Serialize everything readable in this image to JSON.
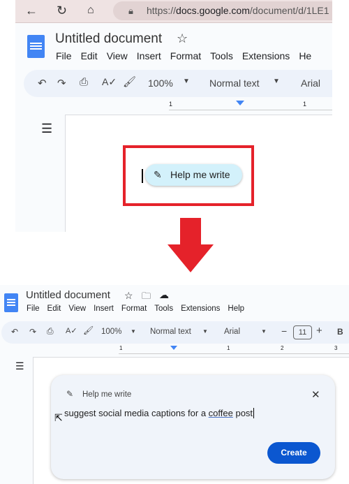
{
  "top": {
    "url_prefix": "https://",
    "url_domain": "docs.google.com",
    "url_path": "/document/d/1LE1",
    "doc_title": "Untitled document",
    "menu": [
      "File",
      "Edit",
      "View",
      "Insert",
      "Format",
      "Tools",
      "Extensions",
      "He"
    ],
    "zoom": "100%",
    "style": "Normal text",
    "font": "Arial",
    "ruler_labels": [
      "1",
      "1"
    ],
    "help_me_write": "Help me write"
  },
  "bottom": {
    "doc_title": "Untitled document",
    "menu": [
      "File",
      "Edit",
      "View",
      "Insert",
      "Format",
      "Tools",
      "Extensions",
      "Help"
    ],
    "zoom": "100%",
    "style": "Normal text",
    "font": "Arial",
    "font_size": "11",
    "bold": "B",
    "ruler_labels": [
      "1",
      "1",
      "2",
      "3"
    ],
    "panel_title": "Help me write",
    "prompt_before": "suggest social media captions for a ",
    "prompt_underlined": "coffee",
    "prompt_after": " post",
    "create_label": "Create"
  },
  "colors": {
    "highlight_box": "#e5222a",
    "arrow": "#e5222a",
    "create_button": "#0b57d0",
    "docs_blue": "#4285f4"
  }
}
